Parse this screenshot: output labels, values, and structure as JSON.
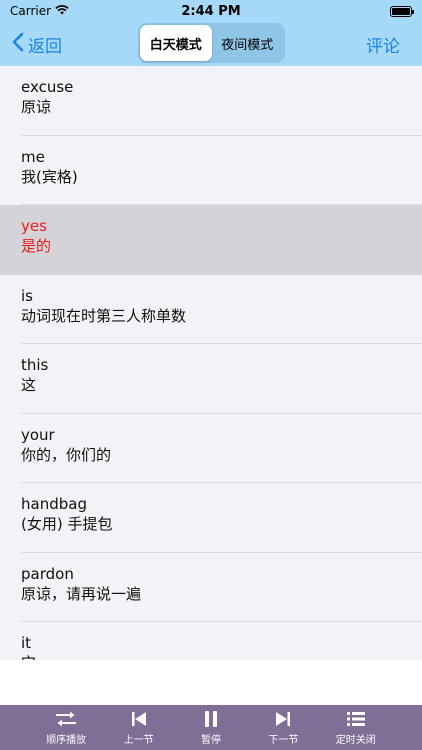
{
  "status_bar": {
    "carrier": "Carrier",
    "time": "2:44 PM"
  },
  "nav": {
    "back_label": "返回",
    "segments": [
      {
        "label": "白天模式",
        "active": true
      },
      {
        "label": "夜间模式",
        "active": false
      }
    ],
    "comment_label": "评论"
  },
  "words": [
    {
      "word": "excuse",
      "meaning": "原谅",
      "selected": false
    },
    {
      "word": "me",
      "meaning": "我(宾格)",
      "selected": false
    },
    {
      "word": "yes",
      "meaning": "是的",
      "selected": true
    },
    {
      "word": "is",
      "meaning": "动词现在时第三人称单数",
      "selected": false
    },
    {
      "word": "this",
      "meaning": "这",
      "selected": false
    },
    {
      "word": "your",
      "meaning": "你的，你们的",
      "selected": false
    },
    {
      "word": "handbag",
      "meaning": "(女用) 手提包",
      "selected": false
    },
    {
      "word": "pardon",
      "meaning": "原谅，请再说一遍",
      "selected": false
    },
    {
      "word": "it",
      "meaning": "它",
      "selected": false
    }
  ],
  "toolbar": {
    "items": [
      {
        "label": "顺序播放",
        "icon": "shuffle-icon"
      },
      {
        "label": "上一节",
        "icon": "previous-icon"
      },
      {
        "label": "暂停",
        "icon": "pause-icon"
      },
      {
        "label": "下一节",
        "icon": "next-icon"
      },
      {
        "label": "定时关闭",
        "icon": "list-icon"
      }
    ]
  },
  "colors": {
    "nav_background": "#a6d8f7",
    "accent": "#1a84e8",
    "selected_text": "#ef1a1a",
    "toolbar_background": "#7f6e95"
  }
}
